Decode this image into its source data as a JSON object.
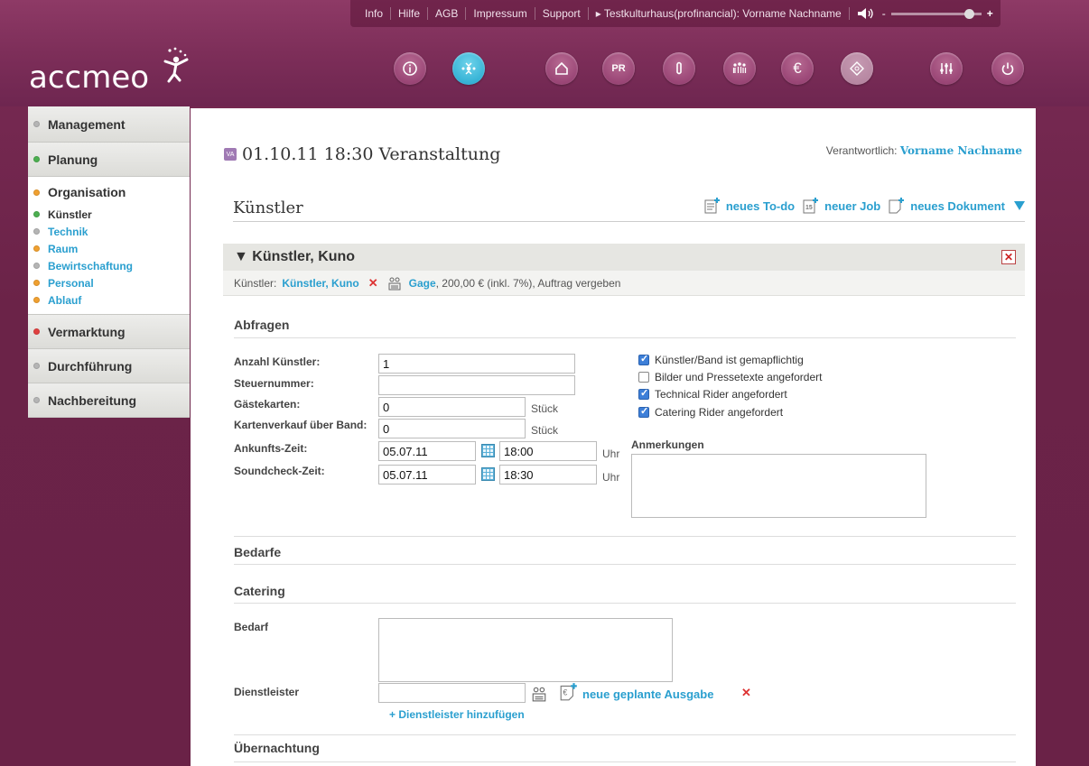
{
  "topbar": {
    "links": [
      "Info",
      "Hilfe",
      "AGB",
      "Impressum",
      "Support"
    ],
    "account": "▸ Testkulturhaus(profinancial): Vorname Nachname",
    "vol_minus": "-",
    "vol_plus": "+"
  },
  "logo": "accmeo",
  "sidebar": {
    "management": "Management",
    "planung": "Planung",
    "organisation": "Organisation",
    "sub": [
      "Künstler",
      "Technik",
      "Raum",
      "Bewirtschaftung",
      "Personal",
      "Ablauf"
    ],
    "vermarktung": "Vermarktung",
    "durchfuehrung": "Durchführung",
    "nachbereitung": "Nachbereitung",
    "colors": {
      "grey": "#a8a8a8",
      "green": "#4caf50",
      "orange": "#f0a030",
      "red": "#e04040"
    }
  },
  "event": {
    "badge": "VA",
    "title": "01.10.11 18:30 Veranstaltung",
    "resp_label": "Verantwortlich:",
    "resp_name": "Vorname Nachname"
  },
  "section": {
    "title": "Künstler",
    "todo": "neues To-do",
    "job": "neuer Job",
    "doc": "neues Dokument"
  },
  "card": {
    "title": "▼ Künstler, Kuno",
    "close": "✕",
    "sub_label": "Künstler:",
    "sub_name": "Künstler, Kuno",
    "sub_remove": "✕",
    "gage": "Gage",
    "gage_rest": ", 200,00 € (inkl. 7%), Auftrag vergeben"
  },
  "abfragen": {
    "title": "Abfragen",
    "anzahl_label": "Anzahl Künstler:",
    "anzahl_value": "1",
    "steuer_label": "Steuernummer:",
    "steuer_value": "",
    "gaeste_label": "Gästekarten:",
    "gaeste_value": "0",
    "gaeste_unit": "Stück",
    "verkauf_label": "Kartenverkauf über Band:",
    "verkauf_value": "0",
    "verkauf_unit": "Stück",
    "ankunft_label": "Ankunfts-Zeit:",
    "ankunft_date": "05.07.11",
    "ankunft_time": "18:00",
    "ankunft_unit": "Uhr",
    "sound_label": "Soundcheck-Zeit:",
    "sound_date": "05.07.11",
    "sound_time": "18:30",
    "sound_unit": "Uhr",
    "checks": [
      {
        "label": "Künstler/Band ist gemapflichtig",
        "checked": true
      },
      {
        "label": "Bilder und Pressetexte angefordert",
        "checked": false
      },
      {
        "label": "Technical Rider angefordert",
        "checked": true
      },
      {
        "label": "Catering Rider angefordert",
        "checked": true
      }
    ],
    "anmerkungen": "Anmerkungen"
  },
  "bedarfe": {
    "title": "Bedarfe"
  },
  "catering": {
    "title": "Catering",
    "bedarf_label": "Bedarf",
    "dienst_label": "Dienstleister",
    "ausgabe": "neue geplante Ausgabe",
    "remove": "✕",
    "add": "+ Dienstleister hinzufügen"
  },
  "uebernachtung": {
    "title": "Übernachtung"
  }
}
